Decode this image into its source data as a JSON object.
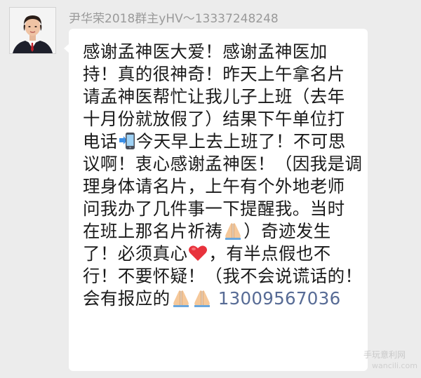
{
  "sender": {
    "name": "尹华荣2018群主yHV～13337248248"
  },
  "message": {
    "line1": "感谢孟神医大爱！感谢孟神医加",
    "line2": "持！真的很神奇！昨天上午拿名片",
    "line3": "请孟神医帮忙让我儿子上班（去年",
    "line4": "十月份就放假了）结果下午单位打",
    "line5a": "电话",
    "line5b": "今天早上去上班了！不可思",
    "line6": "议啊！衷心感谢孟神医！（因我是调",
    "line7": "理身体请名片，上午有个外地老师",
    "line8": "问我办了几件事一下提醒我。当时",
    "line9a": "在班上那名片祈祷",
    "line9b": "）奇迹发生",
    "line10a": "了！必须真心",
    "line10b": "，有半点假也不",
    "line11": "行！不要怀疑！（我不会说谎话的！",
    "line12": "会有报应的",
    "phone": "13009567036"
  },
  "icons": {
    "phone_emoji": "mobile-phone-arrow-icon",
    "pray_emoji": "folded-hands-icon",
    "heart_emoji": "red-heart-icon",
    "heart_color": "#e8323c",
    "link_color": "#576b95"
  },
  "watermark": {
    "logo": "手玩意利网",
    "url": "wancili.com"
  }
}
